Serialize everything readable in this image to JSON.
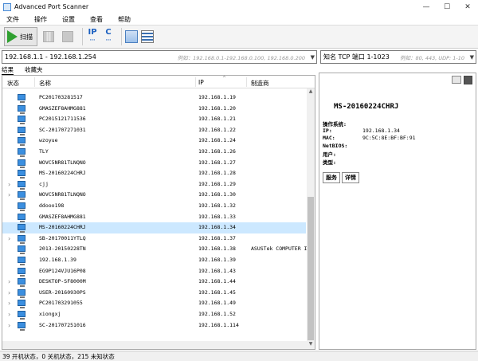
{
  "window": {
    "title": "Advanced Port Scanner"
  },
  "menu": [
    "文件",
    "操作",
    "设置",
    "查看",
    "帮助"
  ],
  "toolbar": {
    "scan_label": "扫描",
    "ip_label": "IP",
    "c_label": "C"
  },
  "range": {
    "value": "192.168.1.1 - 192.168.1.254",
    "hint": "例如：192.168.0.1-192.168.0.100, 192.168.0.200"
  },
  "ports": {
    "value": "知名 TCP 端口 1-1023",
    "hint": "例如：80, 443, UDP: 1-10"
  },
  "tabs": [
    "结果",
    "收藏夹"
  ],
  "columns": {
    "status": "状态",
    "name": "名称",
    "ip": "IP",
    "vendor": "制造商"
  },
  "rows": [
    {
      "name": "PC201703281517",
      "ip": "192.168.1.19",
      "vendor": "",
      "expand": false,
      "selected": false
    },
    {
      "name": "GMASZEF8AHMG881",
      "ip": "192.168.1.20",
      "vendor": "",
      "expand": false,
      "selected": false
    },
    {
      "name": "PC2015121711536",
      "ip": "192.168.1.21",
      "vendor": "",
      "expand": false,
      "selected": false
    },
    {
      "name": "SC-201707271031",
      "ip": "192.168.1.22",
      "vendor": "",
      "expand": false,
      "selected": false
    },
    {
      "name": "wzoyue",
      "ip": "192.168.1.24",
      "vendor": "",
      "expand": false,
      "selected": false
    },
    {
      "name": "TLY",
      "ip": "192.168.1.26",
      "vendor": "",
      "expand": false,
      "selected": false
    },
    {
      "name": "WOVC5NR81TLNQNO",
      "ip": "192.168.1.27",
      "vendor": "",
      "expand": false,
      "selected": false
    },
    {
      "name": "MS-20160224CHRJ",
      "ip": "192.168.1.28",
      "vendor": "",
      "expand": false,
      "selected": false
    },
    {
      "name": "cjj",
      "ip": "192.168.1.29",
      "vendor": "",
      "expand": true,
      "selected": false
    },
    {
      "name": "WOVC5NR81TLNQNO",
      "ip": "192.168.1.30",
      "vendor": "",
      "expand": true,
      "selected": false
    },
    {
      "name": "ddooo198",
      "ip": "192.168.1.32",
      "vendor": "",
      "expand": false,
      "selected": false
    },
    {
      "name": "GMASZEF8AHMG881",
      "ip": "192.168.1.33",
      "vendor": "",
      "expand": false,
      "selected": false
    },
    {
      "name": "MS-20160224CHRJ",
      "ip": "192.168.1.34",
      "vendor": "",
      "expand": false,
      "selected": true
    },
    {
      "name": "SB-20170011YTLQ",
      "ip": "192.168.1.37",
      "vendor": "",
      "expand": true,
      "selected": false
    },
    {
      "name": "2013-20150228TN",
      "ip": "192.168.1.38",
      "vendor": "ASUSTek COMPUTER INC",
      "expand": false,
      "selected": false
    },
    {
      "name": "192.168.1.39",
      "ip": "192.168.1.39",
      "vendor": "",
      "expand": false,
      "selected": false
    },
    {
      "name": "EG9P124VJU16P08",
      "ip": "192.168.1.43",
      "vendor": "",
      "expand": false,
      "selected": false
    },
    {
      "name": "DESKTOP-SF8000M",
      "ip": "192.168.1.44",
      "vendor": "",
      "expand": true,
      "selected": false
    },
    {
      "name": "USER-20160930PS",
      "ip": "192.168.1.45",
      "vendor": "",
      "expand": true,
      "selected": false
    },
    {
      "name": "PC201703291055",
      "ip": "192.168.1.49",
      "vendor": "",
      "expand": true,
      "selected": false
    },
    {
      "name": "xiongxj",
      "ip": "192.168.1.52",
      "vendor": "",
      "expand": true,
      "selected": false
    },
    {
      "name": "SC-201707251016",
      "ip": "192.168.1.114",
      "vendor": "",
      "expand": true,
      "selected": false
    }
  ],
  "details": {
    "host": "MS-20160224CHRJ",
    "fields": [
      {
        "label": "操作系统:",
        "value": ""
      },
      {
        "label": "IP:",
        "value": "192.168.1.34"
      },
      {
        "label": "MAC:",
        "value": "9C:5C:8E:BF:BF:91"
      },
      {
        "label": "NetBIOS:",
        "value": ""
      },
      {
        "label": "用户:",
        "value": ""
      },
      {
        "label": "类型:",
        "value": ""
      }
    ],
    "buttons": [
      "服务",
      "详情"
    ]
  },
  "status": "39 开机状态，0 关机状态，215 未知状态"
}
